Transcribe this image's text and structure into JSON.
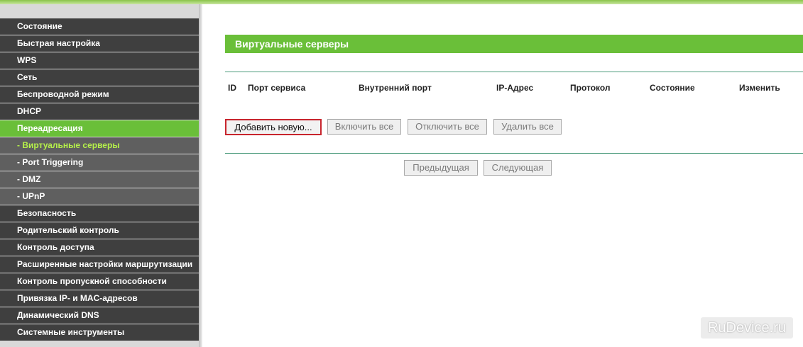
{
  "sidebar": {
    "items": [
      {
        "label": "Состояние",
        "type": "main"
      },
      {
        "label": "Быстрая настройка",
        "type": "main"
      },
      {
        "label": "WPS",
        "type": "main"
      },
      {
        "label": "Сеть",
        "type": "main"
      },
      {
        "label": "Беспроводной режим",
        "type": "main"
      },
      {
        "label": "DHCP",
        "type": "main"
      },
      {
        "label": "Переадресация",
        "type": "active"
      },
      {
        "label": "- Виртуальные серверы",
        "type": "sub-current"
      },
      {
        "label": "- Port Triggering",
        "type": "sub"
      },
      {
        "label": "- DMZ",
        "type": "sub"
      },
      {
        "label": "- UPnP",
        "type": "sub"
      },
      {
        "label": "Безопасность",
        "type": "main"
      },
      {
        "label": "Родительский контроль",
        "type": "main"
      },
      {
        "label": "Контроль доступа",
        "type": "main"
      },
      {
        "label": "Расширенные настройки маршрутизации",
        "type": "main"
      },
      {
        "label": "Контроль пропускной способности",
        "type": "main"
      },
      {
        "label": "Привязка IP- и MAC-адресов",
        "type": "main"
      },
      {
        "label": "Динамический DNS",
        "type": "main"
      },
      {
        "label": "Системные инструменты",
        "type": "main"
      }
    ]
  },
  "main": {
    "title": "Виртуальные серверы",
    "table": {
      "columns": [
        "ID",
        "Порт сервиса",
        "Внутренний порт",
        "IP-Адрес",
        "Протокол",
        "Состояние",
        "Изменить"
      ]
    },
    "buttons": {
      "add_new": "Добавить новую...",
      "enable_all": "Включить все",
      "disable_all": "Отключить все",
      "delete_all": "Удалить все",
      "previous": "Предыдущая",
      "next": "Следующая"
    }
  },
  "watermark": "RuDevice.ru",
  "colors": {
    "accent_green": "#6abf39",
    "nav_dark": "#3f3f3f",
    "nav_sub": "#5f5f5f",
    "highlight_red": "#c8252d"
  }
}
